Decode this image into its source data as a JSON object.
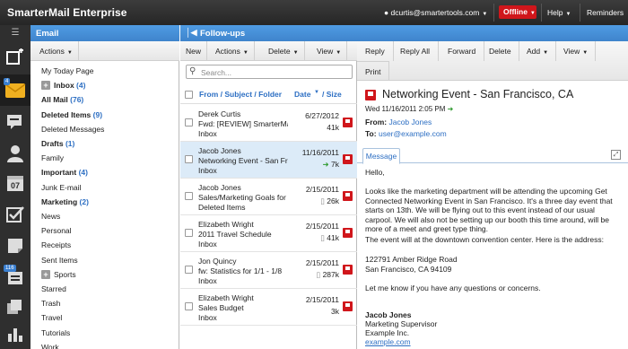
{
  "app": {
    "title": "SmarterMail Enterprise",
    "user": "dcurtis@smartertools.com",
    "status": "Offline",
    "help": "Help",
    "reminders": "Reminders"
  },
  "nav": {
    "mail_badge": "4",
    "contacts_badge": "116",
    "calendar_day": "07"
  },
  "email_pane": {
    "title": "Email",
    "actions_label": "Actions",
    "folders": [
      {
        "name": "My Today Page",
        "count": "",
        "bold": false,
        "plus": false
      },
      {
        "name": "Inbox",
        "count": "(4)",
        "bold": true,
        "plus": true
      },
      {
        "name": "All Mail",
        "count": "(76)",
        "bold": true,
        "plus": false
      },
      {
        "name": "Deleted Items",
        "count": "(9)",
        "bold": true,
        "plus": false
      },
      {
        "name": "Deleted Messages",
        "count": "",
        "bold": false,
        "plus": false
      },
      {
        "name": "Drafts",
        "count": "(1)",
        "bold": true,
        "plus": false
      },
      {
        "name": "Family",
        "count": "",
        "bold": false,
        "plus": false
      },
      {
        "name": "Important",
        "count": "(4)",
        "bold": true,
        "plus": false
      },
      {
        "name": "Junk E-mail",
        "count": "",
        "bold": false,
        "plus": false
      },
      {
        "name": "Marketing",
        "count": "(2)",
        "bold": true,
        "plus": false
      },
      {
        "name": "News",
        "count": "",
        "bold": false,
        "plus": false
      },
      {
        "name": "Personal",
        "count": "",
        "bold": false,
        "plus": false
      },
      {
        "name": "Receipts",
        "count": "",
        "bold": false,
        "plus": false
      },
      {
        "name": "Sent Items",
        "count": "",
        "bold": false,
        "plus": false
      },
      {
        "name": "Sports",
        "count": "",
        "bold": false,
        "plus": true
      },
      {
        "name": "Starred",
        "count": "",
        "bold": false,
        "plus": false
      },
      {
        "name": "Trash",
        "count": "",
        "bold": false,
        "plus": false
      },
      {
        "name": "Travel",
        "count": "",
        "bold": false,
        "plus": false
      },
      {
        "name": "Tutorials",
        "count": "",
        "bold": false,
        "plus": false
      },
      {
        "name": "Work",
        "count": "",
        "bold": false,
        "plus": false
      }
    ]
  },
  "followups": {
    "title": "Follow-ups",
    "toolbar": {
      "new": "New",
      "actions": "Actions",
      "delete": "Delete",
      "view": "View"
    },
    "search_placeholder": "Search...",
    "columns": {
      "from": "From / Subject / Folder",
      "date": "Date",
      "size": "/ Size"
    },
    "messages": [
      {
        "from": "Derek Curtis",
        "subject": "Fwd: [REVIEW] SmarterMail",
        "folder": "Inbox",
        "date": "6/27/2012",
        "size": "41k",
        "selected": false,
        "icon": ""
      },
      {
        "from": "Jacob Jones",
        "subject": "Networking Event - San Francisco",
        "folder": "Inbox",
        "date": "11/16/2011",
        "size": "7k",
        "selected": true,
        "icon": "fwd"
      },
      {
        "from": "Jacob Jones",
        "subject": "Sales/Marketing Goals for Q",
        "folder": "Deleted Items",
        "date": "2/15/2011",
        "size": "26k",
        "selected": false,
        "icon": "clip"
      },
      {
        "from": "Elizabeth Wright",
        "subject": "2011 Travel Schedule",
        "folder": "Inbox",
        "date": "2/15/2011",
        "size": "41k",
        "selected": false,
        "icon": "clip"
      },
      {
        "from": "Jon Quincy",
        "subject": "fw: Statistics for 1/1 - 1/8",
        "folder": "Inbox",
        "date": "2/15/2011",
        "size": "287k",
        "selected": false,
        "icon": "clip"
      },
      {
        "from": "Elizabeth Wright",
        "subject": "Sales Budget",
        "folder": "Inbox",
        "date": "2/15/2011",
        "size": "3k",
        "selected": false,
        "icon": ""
      }
    ]
  },
  "reading": {
    "toolbar": {
      "reply": "Reply",
      "reply_all": "Reply All",
      "forward": "Forward",
      "delete": "Delete",
      "add": "Add",
      "view": "View",
      "print": "Print"
    },
    "subject": "Networking Event - San Francisco, CA",
    "datetime": "Wed 11/16/2011 2:05 PM",
    "from_label": "From:",
    "from": "Jacob Jones",
    "to_label": "To:",
    "to": "user@example.com",
    "tab": "Message",
    "greeting": "Hello,",
    "p1": "Looks like the marketing department will be attending the upcoming Get Connected Networking Event in San Francisco. It's a three day event that starts on 13th. We will be flying out to this event instead of our usual carpool.  We will also not be setting up our booth this time around, will be more of a meet and greet type thing.",
    "p2": "The event will at the downtown convention center. Here is the address:",
    "addr1": "122791 Amber Ridge Road",
    "addr2": "San Francisco, CA  94109",
    "p3": "Let me know if you have any questions or concerns.",
    "sig_name": "Jacob Jones",
    "sig_title": "Marketing Supervisor",
    "sig_company": "Example Inc.",
    "sig_link": "example.com"
  },
  "colors": {
    "accent": "#3f84cc",
    "flag": "#d0161b",
    "offline": "#d0161b"
  }
}
